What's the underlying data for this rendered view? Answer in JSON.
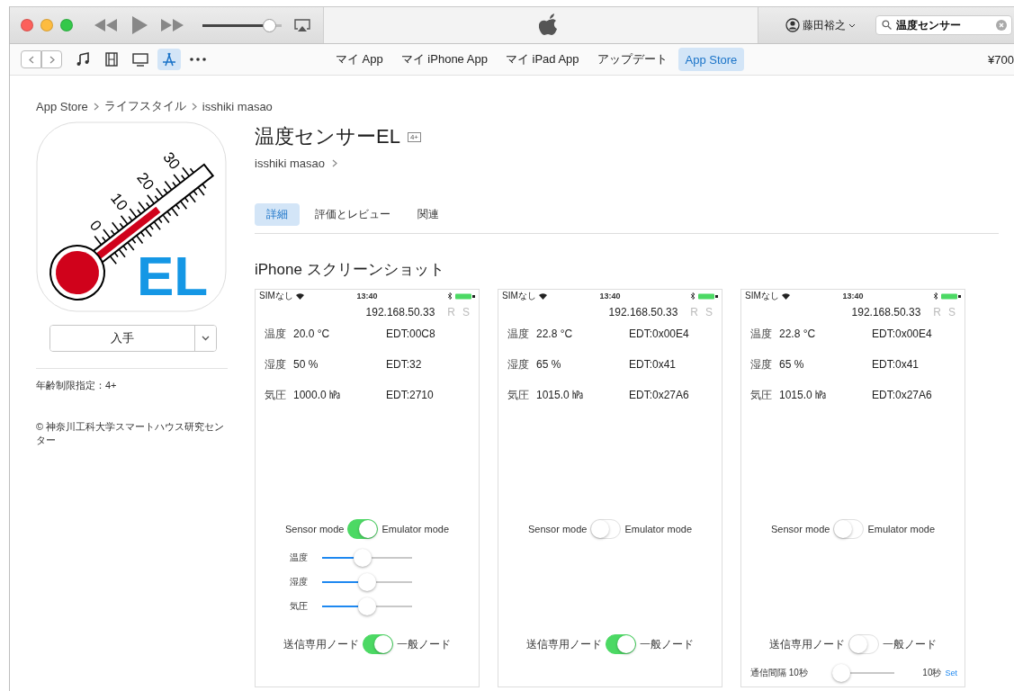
{
  "player": {
    "volume": {
      "level": 0.85
    }
  },
  "account": {
    "name": "藤田裕之"
  },
  "search": {
    "value": "温度センサー"
  },
  "media": [
    {
      "kind": "music",
      "selected": false
    },
    {
      "kind": "movies",
      "selected": false
    },
    {
      "kind": "tv",
      "selected": false
    },
    {
      "kind": "apps",
      "selected": true
    },
    {
      "kind": "more",
      "selected": false
    }
  ],
  "nav_tabs": [
    {
      "label": "マイ App",
      "selected": false
    },
    {
      "label": "マイ iPhone App",
      "selected": false
    },
    {
      "label": "マイ iPad App",
      "selected": false
    },
    {
      "label": "アップデート",
      "selected": false
    },
    {
      "label": "App Store",
      "selected": true
    }
  ],
  "balance": "¥700",
  "breadcrumb": [
    "App Store",
    "ライフスタイル",
    "isshiki masao"
  ],
  "app": {
    "icon": {
      "scale": [
        "0",
        "10",
        "20",
        "30"
      ],
      "badge": "EL"
    },
    "title": "温度センサーEL",
    "age_badge": "4+",
    "developer": "isshiki masao",
    "get_button": "入手",
    "rating": "年齢制限指定：4+",
    "copyright": "© 神奈川工科大学スマートハウス研究センター"
  },
  "tabs": [
    {
      "label": "詳細",
      "selected": true
    },
    {
      "label": "評価とレビュー",
      "selected": false
    },
    {
      "label": "関連",
      "selected": false
    }
  ],
  "section_title": "iPhone スクリーンショット",
  "screenshots": [
    {
      "carrier": "SIMなし",
      "time": "13:40",
      "address": "192.168.50.33",
      "r": "R",
      "s": "S",
      "readings": [
        {
          "label": "温度",
          "value": "20.0 °C",
          "edt": "EDT:00C8"
        },
        {
          "label": "湿度",
          "value": "50 %",
          "edt": "EDT:32"
        },
        {
          "label": "気圧",
          "value": "1000.0 ㍱",
          "edt": "EDT:2710"
        }
      ],
      "mode": {
        "left": "Sensor mode",
        "right": "Emulator mode",
        "on": true
      },
      "sliders": [
        {
          "label": "温度",
          "level": 0.45
        },
        {
          "label": "湿度",
          "level": 0.5
        },
        {
          "label": "気圧",
          "level": 0.5
        }
      ],
      "node": {
        "left": "送信専用ノード",
        "right": "一般ノード",
        "on": true
      }
    },
    {
      "carrier": "SIMなし",
      "time": "13:40",
      "address": "192.168.50.33",
      "r": "R",
      "s": "S",
      "readings": [
        {
          "label": "温度",
          "value": "22.8 °C",
          "edt": "EDT:0x00E4"
        },
        {
          "label": "湿度",
          "value": "65 %",
          "edt": "EDT:0x41"
        },
        {
          "label": "気圧",
          "value": "1015.0 ㍱",
          "edt": "EDT:0x27A6"
        }
      ],
      "mode": {
        "left": "Sensor mode",
        "right": "Emulator mode",
        "on": false
      },
      "node": {
        "left": "送信専用ノード",
        "right": "一般ノード",
        "on": true
      }
    },
    {
      "carrier": "SIMなし",
      "time": "13:40",
      "address": "192.168.50.33",
      "r": "R",
      "s": "S",
      "readings": [
        {
          "label": "温度",
          "value": "22.8 °C",
          "edt": "EDT:0x00E4"
        },
        {
          "label": "湿度",
          "value": "65 %",
          "edt": "EDT:0x41"
        },
        {
          "label": "気圧",
          "value": "1015.0 ㍱",
          "edt": "EDT:0x27A6"
        }
      ],
      "mode": {
        "left": "Sensor mode",
        "right": "Emulator mode",
        "on": false
      },
      "node": {
        "left": "送信専用ノード",
        "right": "一般ノード",
        "on": false
      },
      "interval": {
        "label": "通信間隔 10秒",
        "level": 0.1,
        "value": "10秒",
        "action": "Set"
      }
    }
  ]
}
